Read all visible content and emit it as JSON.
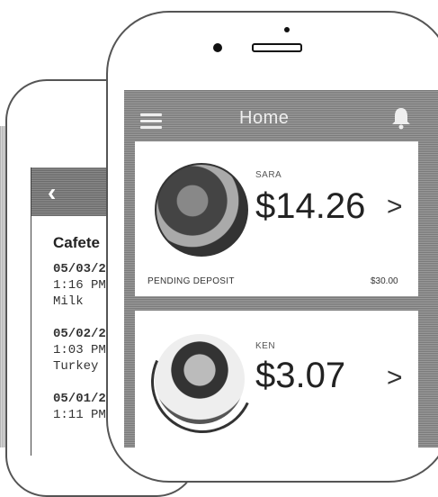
{
  "back_screen": {
    "title": "Cafete",
    "transactions": [
      {
        "date": "05/03/2",
        "time": "1:16 PM",
        "item": "Milk"
      },
      {
        "date": "05/02/2",
        "time": "1:03 PM",
        "item": "Turkey"
      },
      {
        "date": "05/01/2",
        "time": "1:11 PM",
        "item": ""
      }
    ]
  },
  "front_screen": {
    "header": {
      "title": "Home",
      "menu_icon": "hamburger-icon",
      "bell_icon": "bell-icon"
    },
    "children": [
      {
        "name": "SARA",
        "balance": "$14.26",
        "pending_label": "PENDING DEPOSIT",
        "pending_amount": "$30.00"
      },
      {
        "name": "KEN",
        "balance": "$3.07"
      }
    ]
  },
  "colors": {
    "header_gray": "#8a8a8a",
    "card_bg": "#ffffff"
  }
}
